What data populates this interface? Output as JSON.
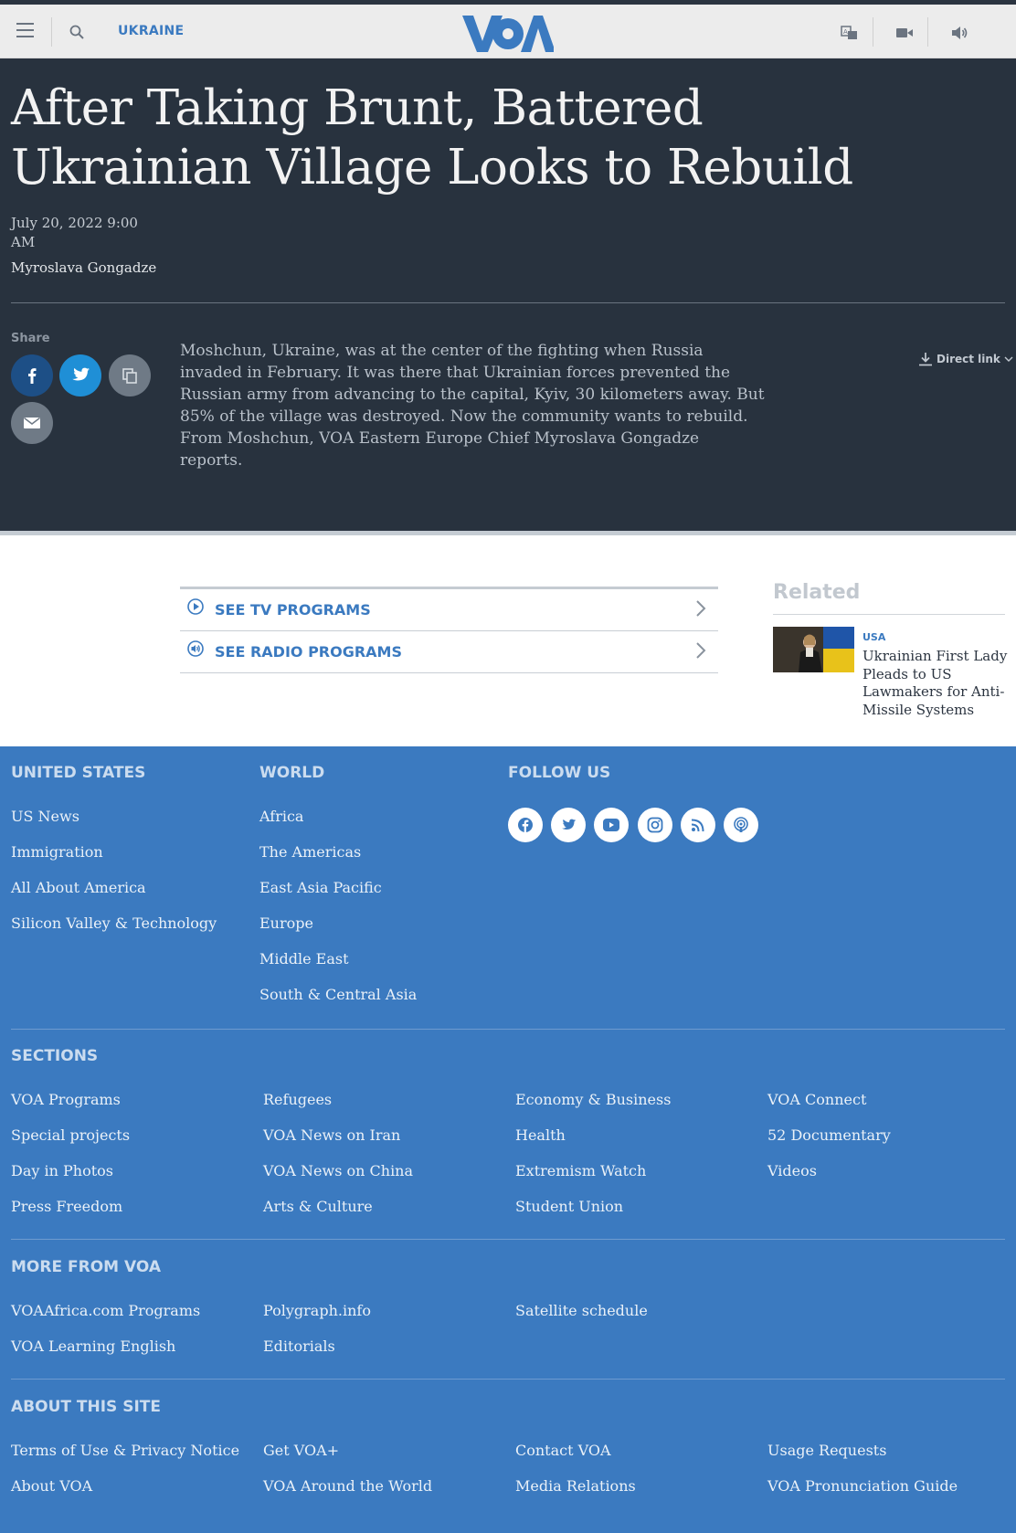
{
  "nav": {
    "section_label": "UKRAINE",
    "logo_text": "VOA"
  },
  "article": {
    "title": "After Taking Brunt, Battered Ukrainian Village Looks to Rebuild",
    "date": "July 20, 2022 9:00 AM",
    "author": "Myroslava Gongadze",
    "share_label": "Share",
    "summary": "Moshchun, Ukraine, was at the center of the fighting when Russia invaded in February. It was there that Ukrainian forces prevented the Russian army from advancing to the capital, Kyiv, 30 kilometers away. But 85% of the village was destroyed. Now the community wants to rebuild. From Moshchun, VOA Eastern Europe Chief Myroslava Gongadze reports.",
    "direct_link": "Direct link"
  },
  "programs": {
    "tv": "SEE TV PROGRAMS",
    "radio": "SEE RADIO PROGRAMS"
  },
  "related": {
    "title": "Related",
    "category": "USA",
    "headline": "Ukrainian First Lady Pleads to US Lawmakers for Anti-Missile Systems"
  },
  "footer": {
    "united_states": {
      "heading": "UNITED STATES",
      "links": [
        "US News",
        "Immigration",
        "All About America",
        "Silicon Valley & Technology"
      ]
    },
    "world": {
      "heading": "WORLD",
      "links": [
        "Africa",
        "The Americas",
        "East Asia Pacific",
        "Europe",
        "Middle East",
        "South & Central Asia"
      ]
    },
    "follow": {
      "heading": "FOLLOW US",
      "icons": [
        "facebook-icon",
        "twitter-icon",
        "youtube-icon",
        "instagram-icon",
        "rss-icon",
        "podcast-icon"
      ]
    },
    "sections": {
      "heading": "SECTIONS",
      "links": [
        "VOA Programs",
        "Special projects",
        "Day in Photos",
        "Press Freedom",
        "Refugees",
        "VOA News on Iran",
        "VOA News on China",
        "Arts & Culture",
        "Economy & Business",
        "Health",
        "Extremism Watch",
        "Student Union",
        "VOA Connect",
        "52 Documentary",
        "Videos"
      ]
    },
    "more": {
      "heading": "MORE FROM VOA",
      "links": [
        "VOAAfrica.com Programs",
        "VOA Learning English",
        "Polygraph.info",
        "Editorials",
        "Satellite schedule"
      ]
    },
    "about": {
      "heading": "ABOUT THIS SITE",
      "links": [
        "Terms of Use & Privacy Notice",
        "About VOA",
        "Get VOA+",
        "VOA Around the World",
        "Contact VOA",
        "Media Relations",
        "Usage Requests",
        "VOA Pronunciation Guide"
      ]
    }
  },
  "colors": {
    "brand_blue": "#3b7ac0",
    "hero_dark": "#28323e",
    "facebook": "#1d4f86",
    "twitter": "#1f8fd6"
  }
}
